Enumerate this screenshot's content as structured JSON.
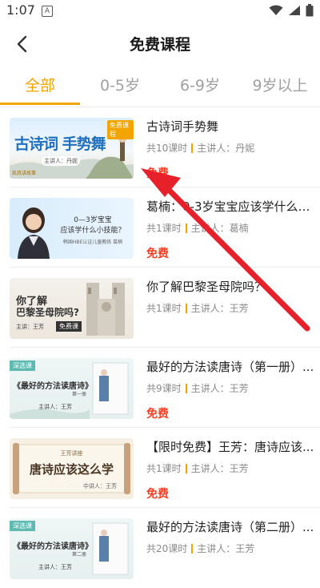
{
  "status_bar": {
    "time": "1:07",
    "notification_letter": "A"
  },
  "nav": {
    "title": "免费课程"
  },
  "tabs": [
    {
      "label": "全部",
      "active": true
    },
    {
      "label": "0-5岁",
      "active": false
    },
    {
      "label": "6-9岁",
      "active": false
    },
    {
      "label": "9岁以上",
      "active": false
    }
  ],
  "courses": [
    {
      "title": "古诗词手势舞",
      "lessons": "共10课时",
      "teacher": "主讲人：丹妮",
      "price": "免费",
      "thumb": {
        "headline": "古诗词 手势舞",
        "badge": "免费课程",
        "speaker": "主讲人：丹妮",
        "logo": "凯叔讲故事"
      }
    },
    {
      "title": "葛楠：0-3岁宝宝应该学什么小...",
      "lessons": "共1课时",
      "teacher": "主讲人：葛楠",
      "price": "免费",
      "thumb": {
        "line1": "0—3岁宝宝",
        "line2": "应该学什么小技能？",
        "caption": "韩国HBE认证儿童教练 葛楠"
      }
    },
    {
      "title": "你了解巴黎圣母院吗？",
      "lessons": "共1课时",
      "teacher": "主讲人：王芳",
      "price": "",
      "thumb": {
        "line1": "你了解",
        "line2": "巴黎圣母院吗?",
        "speaker": "主讲：王芳",
        "badge": "免费课"
      }
    },
    {
      "title": "最好的方法读唐诗（第一册）...",
      "lessons": "共9课时",
      "teacher": "主讲人：王芳",
      "price": "免费",
      "thumb": {
        "badge": "深选课",
        "headline": "《最好的方法读唐诗》",
        "sub": "第一册",
        "speaker": "主讲人：王芳"
      }
    },
    {
      "title": "【限时免费】王芳：唐诗应该...",
      "lessons": "共1课时",
      "teacher": "主讲人：王芳",
      "price": "免费",
      "thumb": {
        "top": "王芳讲座",
        "headline": "唐诗应该这么学",
        "speaker": "中讲人：王芳"
      }
    },
    {
      "title": "最好的方法读唐诗（第二册）...",
      "lessons": "共20课时",
      "teacher": "主讲人：王芳",
      "price": "",
      "thumb": {
        "badge": "深选课",
        "headline": "《最好的方法读唐诗》",
        "sub": "第二册",
        "speaker": "主讲人：王芳"
      }
    }
  ],
  "colors": {
    "accent": "#f2a400",
    "price": "#ff3b1f",
    "annotation_arrow": "#e8202a"
  }
}
